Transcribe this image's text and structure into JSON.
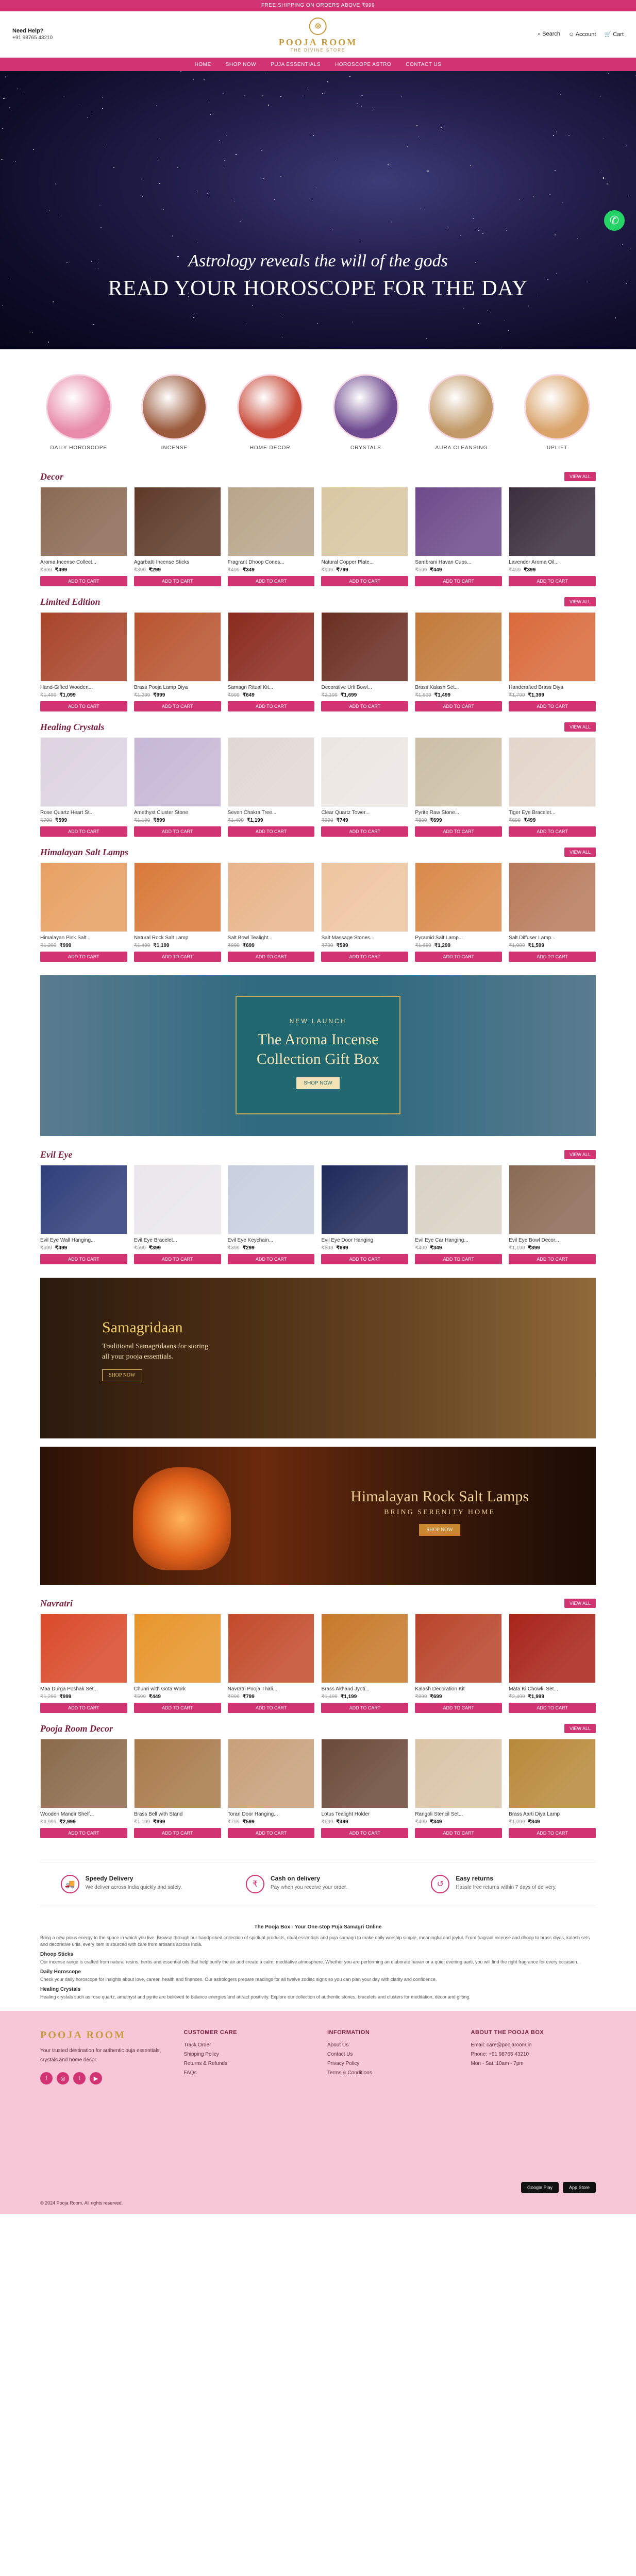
{
  "topbar": {
    "text": "FREE SHIPPING ON ORDERS ABOVE ₹999"
  },
  "header": {
    "help_label": "Need Help?",
    "help_phone": "+91 98765 43210",
    "logo_name": "POOJA ROOM",
    "logo_tag": "THE DIVINE STORE",
    "search_label": "Search",
    "account_label": "Account",
    "cart_label": "Cart"
  },
  "nav": [
    "Home",
    "Shop Now",
    "Puja Essentials",
    "Horoscope Astro",
    "Contact Us"
  ],
  "hero": {
    "subtitle": "Astrology reveals the will of the gods",
    "title": "READ YOUR HOROSCOPE FOR THE DAY"
  },
  "categories": [
    {
      "label": "Daily Horoscope",
      "color": "#e88bab"
    },
    {
      "label": "Incense",
      "color": "#9a5a3c"
    },
    {
      "label": "Home Decor",
      "color": "#c84b3a"
    },
    {
      "label": "Crystals",
      "color": "#6f4b8f"
    },
    {
      "label": "Aura Cleansing",
      "color": "#c29a6a"
    },
    {
      "label": "Uplift",
      "color": "#d9a36a"
    }
  ],
  "sections": {
    "decor": {
      "title": "Decor",
      "view_all": "VIEW ALL",
      "items": [
        {
          "name": "Aroma Incense Collect...",
          "old": "₹699",
          "price": "₹499",
          "btn": "ADD TO CART",
          "color": "#8a6a54"
        },
        {
          "name": "Agarbatti Incense Sticks",
          "old": "₹399",
          "price": "₹299",
          "btn": "ADD TO CART",
          "color": "#5e3a28"
        },
        {
          "name": "Fragrant Dhoop Cones...",
          "old": "₹499",
          "price": "₹349",
          "btn": "ADD TO CART",
          "color": "#b9a58a"
        },
        {
          "name": "Natural Copper Plate...",
          "old": "₹999",
          "price": "₹799",
          "btn": "ADD TO CART",
          "color": "#d9c7a2"
        },
        {
          "name": "Sambrani Havan Cups...",
          "old": "₹599",
          "price": "₹449",
          "btn": "ADD TO CART",
          "color": "#6e4a8a"
        },
        {
          "name": "Lavender Aroma Oil...",
          "old": "₹499",
          "price": "₹399",
          "btn": "ADD TO CART",
          "color": "#3b2e3e"
        }
      ]
    },
    "limited": {
      "title": "Limited Edition",
      "view_all": "VIEW ALL",
      "items": [
        {
          "name": "Hand-Gifted Wooden...",
          "old": "₹1,499",
          "price": "₹1,099",
          "btn": "ADD TO CART",
          "color": "#a8442a"
        },
        {
          "name": "Brass Pooja Lamp Diya",
          "old": "₹1,299",
          "price": "₹999",
          "btn": "ADD TO CART",
          "color": "#b8542e"
        },
        {
          "name": "Samagri Ritual Kit...",
          "old": "₹999",
          "price": "₹649",
          "btn": "ADD TO CART",
          "color": "#8a2a1e"
        },
        {
          "name": "Decorative Urli Bowl...",
          "old": "₹2,199",
          "price": "₹1,699",
          "btn": "ADD TO CART",
          "color": "#6a2e22"
        },
        {
          "name": "Brass Kalash Set...",
          "old": "₹1,899",
          "price": "₹1,499",
          "btn": "ADD TO CART",
          "color": "#c27a3a"
        },
        {
          "name": "Handcrafted Brass Diya",
          "old": "₹1,799",
          "price": "₹1,399",
          "btn": "ADD TO CART",
          "color": "#d96a3a"
        }
      ]
    },
    "crystals": {
      "title": "Healing Crystals",
      "view_all": "VIEW ALL",
      "items": [
        {
          "name": "Rose Quartz Heart St...",
          "old": "₹799",
          "price": "₹599",
          "btn": "ADD TO CART",
          "color": "#ddd3e2"
        },
        {
          "name": "Amethyst Cluster Stone",
          "old": "₹1,199",
          "price": "₹899",
          "btn": "ADD TO CART",
          "color": "#c7b7d6"
        },
        {
          "name": "Seven Chakra Tree...",
          "old": "₹1,499",
          "price": "₹1,199",
          "btn": "ADD TO CART",
          "color": "#e0d8d4"
        },
        {
          "name": "Clear Quartz Tower...",
          "old": "₹999",
          "price": "₹749",
          "btn": "ADD TO CART",
          "color": "#ece6e2"
        },
        {
          "name": "Pyrite Raw Stone...",
          "old": "₹899",
          "price": "₹699",
          "btn": "ADD TO CART",
          "color": "#cdbfa6"
        },
        {
          "name": "Tiger Eye Bracelet...",
          "old": "₹699",
          "price": "₹499",
          "btn": "ADD TO CART",
          "color": "#e3d6cb"
        }
      ]
    },
    "salt": {
      "title": "Himalayan Salt Lamps",
      "view_all": "VIEW ALL",
      "items": [
        {
          "name": "Himalayan Pink Salt...",
          "old": "₹1,299",
          "price": "₹999",
          "btn": "ADD TO CART",
          "color": "#e7a062"
        },
        {
          "name": "Natural Rock Salt Lamp",
          "old": "₹1,499",
          "price": "₹1,199",
          "btn": "ADD TO CART",
          "color": "#d97a3a"
        },
        {
          "name": "Salt Bowl Tealight...",
          "old": "₹899",
          "price": "₹699",
          "btn": "ADD TO CART",
          "color": "#e8b48a"
        },
        {
          "name": "Salt Massage Stones...",
          "old": "₹799",
          "price": "₹599",
          "btn": "ADD TO CART",
          "color": "#eec5a0"
        },
        {
          "name": "Pyramid Salt Lamp...",
          "old": "₹1,699",
          "price": "₹1,299",
          "btn": "ADD TO CART",
          "color": "#d98a4a"
        },
        {
          "name": "Salt Diffuser Lamp...",
          "old": "₹1,999",
          "price": "₹1,599",
          "btn": "ADD TO CART",
          "color": "#b87a5a"
        }
      ]
    },
    "evil": {
      "title": "Evil Eye",
      "view_all": "VIEW ALL",
      "items": [
        {
          "name": "Evil Eye Wall Hanging...",
          "old": "₹699",
          "price": "₹499",
          "btn": "ADD TO CART",
          "color": "#2f3e7a"
        },
        {
          "name": "Evil Eye Bracelet...",
          "old": "₹599",
          "price": "₹399",
          "btn": "ADD TO CART",
          "color": "#e9e7ec"
        },
        {
          "name": "Evil Eye Keychain...",
          "old": "₹399",
          "price": "₹299",
          "btn": "ADD TO CART",
          "color": "#c9cfe0"
        },
        {
          "name": "Evil Eye Door Hanging",
          "old": "₹899",
          "price": "₹699",
          "btn": "ADD TO CART",
          "color": "#1f2a5a"
        },
        {
          "name": "Evil Eye Car Hanging...",
          "old": "₹499",
          "price": "₹349",
          "btn": "ADD TO CART",
          "color": "#d9d2c4"
        },
        {
          "name": "Evil Eye Bowl Decor...",
          "old": "₹1,199",
          "price": "₹899",
          "btn": "ADD TO CART",
          "color": "#8a6a54"
        }
      ]
    },
    "navratri": {
      "title": "Navratri",
      "view_all": "VIEW ALL",
      "items": [
        {
          "name": "Maa Durga Poshak Set...",
          "old": "₹1,299",
          "price": "₹999",
          "btn": "ADD TO CART",
          "color": "#d94a2a"
        },
        {
          "name": "Chunri with Gota Work",
          "old": "₹599",
          "price": "₹449",
          "btn": "ADD TO CART",
          "color": "#e7952a"
        },
        {
          "name": "Navratri Pooja Thali...",
          "old": "₹999",
          "price": "₹799",
          "btn": "ADD TO CART",
          "color": "#c24a2a"
        },
        {
          "name": "Brass Akhand Jyoti...",
          "old": "₹1,499",
          "price": "₹1,199",
          "btn": "ADD TO CART",
          "color": "#c7792a"
        },
        {
          "name": "Kalash Decoration Kit",
          "old": "₹899",
          "price": "₹699",
          "btn": "ADD TO CART",
          "color": "#b8442a"
        },
        {
          "name": "Mata Ki Chowki Set...",
          "old": "₹2,499",
          "price": "₹1,999",
          "btn": "ADD TO CART",
          "color": "#a8241a"
        }
      ]
    },
    "poojaroom": {
      "title": "Pooja Room Decor",
      "view_all": "VIEW ALL",
      "items": [
        {
          "name": "Wooden Mandir Shelf...",
          "old": "₹3,999",
          "price": "₹2,999",
          "btn": "ADD TO CART",
          "color": "#8a6a4a"
        },
        {
          "name": "Brass Bell with Stand",
          "old": "₹1,199",
          "price": "₹899",
          "btn": "ADD TO CART",
          "color": "#a87a4a"
        },
        {
          "name": "Toran Door Hanging...",
          "old": "₹799",
          "price": "₹599",
          "btn": "ADD TO CART",
          "color": "#c8a07a"
        },
        {
          "name": "Lotus Tealight Holder",
          "old": "₹699",
          "price": "₹499",
          "btn": "ADD TO CART",
          "color": "#6a4a3a"
        },
        {
          "name": "Rangoli Stencil Set...",
          "old": "₹499",
          "price": "₹349",
          "btn": "ADD TO CART",
          "color": "#d9c4a6"
        },
        {
          "name": "Brass Aarti Diya Lamp",
          "old": "₹1,099",
          "price": "₹849",
          "btn": "ADD TO CART",
          "color": "#b8893a"
        }
      ]
    }
  },
  "banner_gift": {
    "new": "NEW LAUNCH",
    "title": "The Aroma Incense Collection Gift Box",
    "btn": "SHOP NOW"
  },
  "banner_samagri": {
    "title": "Samagridaan",
    "line1": "Traditional Samagridaans for storing",
    "line2": "all your pooja essentials.",
    "btn": "SHOP NOW"
  },
  "banner_salt": {
    "title": "Himalayan Rock Salt Lamps",
    "sub": "BRING SERENITY HOME",
    "btn": "SHOP NOW"
  },
  "features": [
    {
      "icon": "delivery-icon",
      "title": "Speedy Delivery",
      "desc": "We deliver across India quickly and safely."
    },
    {
      "icon": "cash-icon",
      "title": "Cash on delivery",
      "desc": "Pay when you receive your order."
    },
    {
      "icon": "returns-icon",
      "title": "Easy returns",
      "desc": "Hassle free returns within 7 days of delivery."
    }
  ],
  "seo": {
    "title": "The Pooja Box - Your One-stop Puja Samagri Online",
    "heading_1": "Dhoop Sticks",
    "heading_2": "Daily Horoscope",
    "heading_3": "Healing Crystals",
    "p1": "Bring a new pious energy to the space in which you live. Browse through our handpicked collection of spiritual products, ritual essentials and puja samagri to make daily worship simple, meaningful and joyful. From fragrant incense and dhoop to brass diyas, kalash sets and decorative urlis, every item is sourced with care from artisans across India.",
    "p2": "Our incense range is crafted from natural resins, herbs and essential oils that help purify the air and create a calm, meditative atmosphere. Whether you are performing an elaborate havan or a quiet evening aarti, you will find the right fragrance for every occasion.",
    "p3": "Check your daily horoscope for insights about love, career, health and finances. Our astrologers prepare readings for all twelve zodiac signs so you can plan your day with clarity and confidence.",
    "p4": "Healing crystals such as rose quartz, amethyst and pyrite are believed to balance energies and attract positivity. Explore our collection of authentic stones, bracelets and clusters for meditation, décor and gifting."
  },
  "footer": {
    "logo": "POOJA ROOM",
    "about": "Your trusted destination for authentic puja essentials, crystals and home décor.",
    "col2_title": "Customer Care",
    "col2": [
      "Track Order",
      "Shipping Policy",
      "Returns & Refunds",
      "FAQs"
    ],
    "col3_title": "Information",
    "col3": [
      "About Us",
      "Contact Us",
      "Privacy Policy",
      "Terms & Conditions"
    ],
    "col4_title": "About The Pooja Box",
    "col4": [
      "Email: care@poojaroom.in",
      "Phone: +91 98765 43210",
      "Mon - Sat: 10am - 7pm"
    ],
    "store1": "Google Play",
    "store2": "App Store",
    "copyright": "© 2024 Pooja Room. All rights reserved."
  }
}
